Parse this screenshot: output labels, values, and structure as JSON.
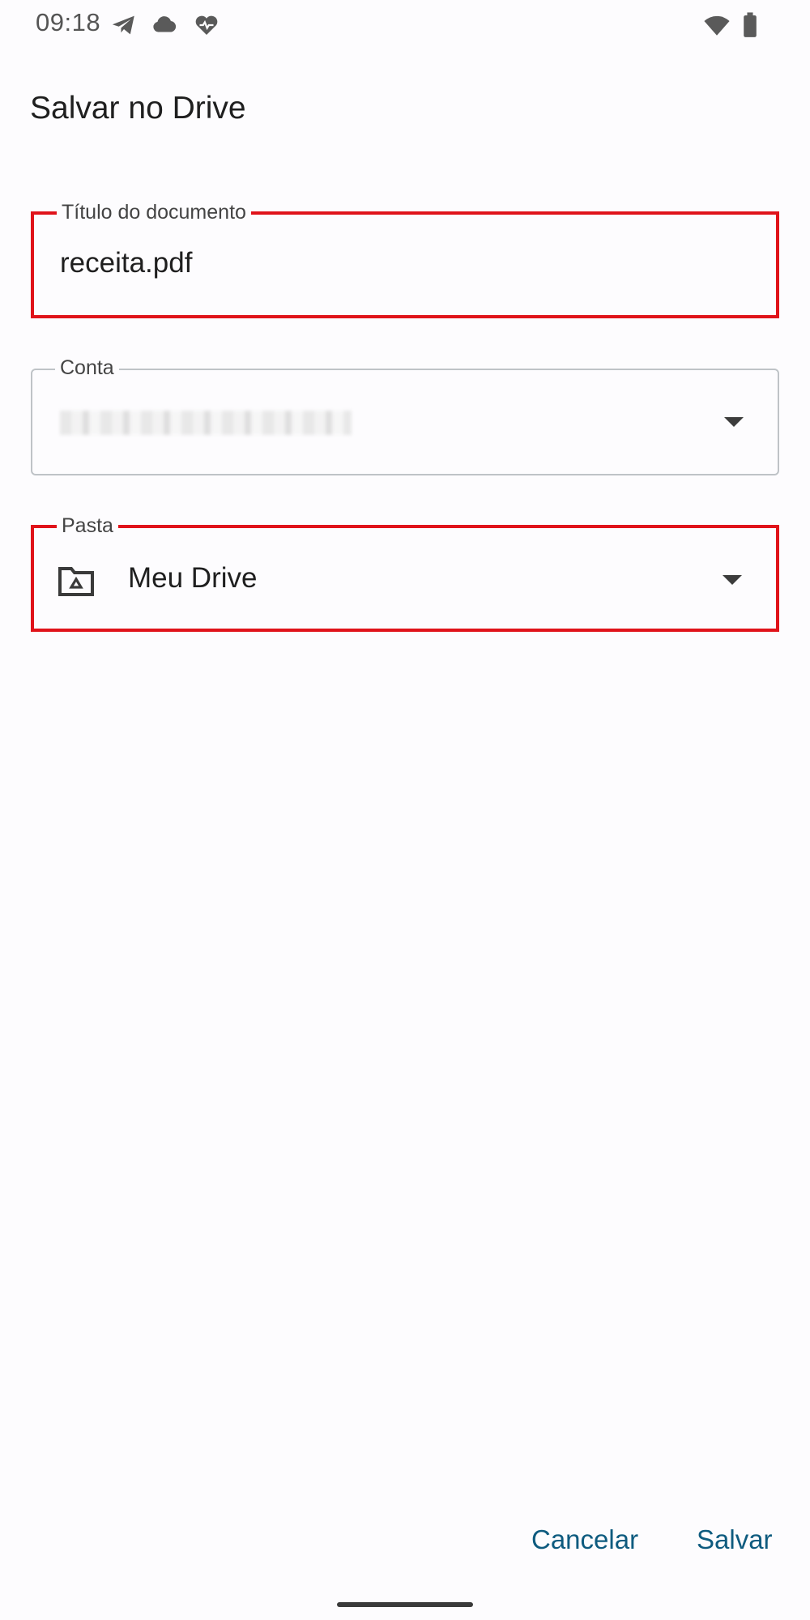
{
  "status_bar": {
    "time": "09:18",
    "icons": [
      "telegram-icon",
      "cloud-icon",
      "heart-pulse-icon",
      "wifi-icon",
      "battery-icon"
    ]
  },
  "dialog": {
    "title": "Salvar no Drive"
  },
  "fields": {
    "document_title": {
      "label": "Título do documento",
      "value": "receita.pdf"
    },
    "account": {
      "label": "Conta",
      "value": ""
    },
    "folder": {
      "label": "Pasta",
      "value": "Meu Drive",
      "icon": "drive-folder-icon"
    }
  },
  "actions": {
    "cancel_label": "Cancelar",
    "save_label": "Salvar"
  },
  "colors": {
    "highlight": "#e0131a",
    "accent": "#0e5b7f"
  }
}
